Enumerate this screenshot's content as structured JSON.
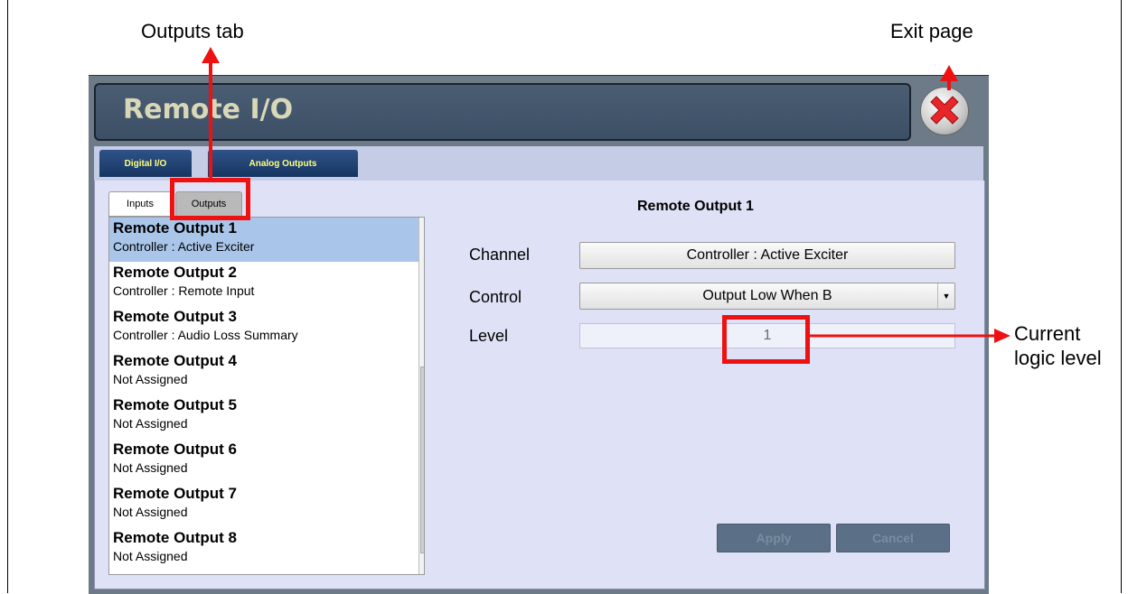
{
  "annotations": {
    "outputs_tab": "Outputs tab",
    "exit_page": "Exit page",
    "current_logic_level_line1": "Current",
    "current_logic_level_line2": "logic level"
  },
  "window": {
    "title": "Remote I/O",
    "tabs": [
      "Digital I/O",
      "Analog Outputs"
    ],
    "subtabs": [
      "Inputs",
      "Outputs"
    ],
    "list_items": [
      {
        "title": "Remote Output 1",
        "sub": "Controller : Active Exciter"
      },
      {
        "title": "Remote Output 2",
        "sub": "Controller : Remote Input"
      },
      {
        "title": "Remote Output 3",
        "sub": "Controller : Audio Loss Summary"
      },
      {
        "title": "Remote Output 4",
        "sub": "Not Assigned"
      },
      {
        "title": "Remote Output 5",
        "sub": "Not Assigned"
      },
      {
        "title": "Remote Output 6",
        "sub": "Not Assigned"
      },
      {
        "title": "Remote Output 7",
        "sub": "Not Assigned"
      },
      {
        "title": "Remote Output 8",
        "sub": "Not Assigned"
      }
    ],
    "detail": {
      "title": "Remote Output 1",
      "channel_label": "Channel",
      "channel_value": "Controller : Active Exciter",
      "control_label": "Control",
      "control_value": "Output Low When B",
      "level_label": "Level",
      "level_value": "1",
      "apply_label": "Apply",
      "cancel_label": "Cancel"
    }
  },
  "colors": {
    "annotation_red": "#ee1111",
    "tab_text": "#ffff80",
    "selected_row": "#a9c6ea"
  }
}
